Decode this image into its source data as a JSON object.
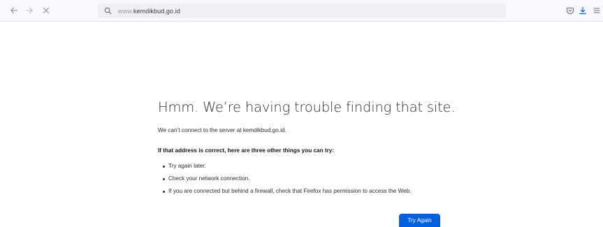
{
  "browser": {
    "icons": {
      "back": "arrow-left-icon",
      "forward": "arrow-right-icon",
      "stop": "close-icon",
      "search": "search-icon",
      "pocket": "pocket-icon",
      "downloads": "download-icon",
      "menu": "hamburger-menu-icon"
    },
    "urlbar": {
      "prefix": "www.",
      "domain": "kemdikbud.go.id"
    },
    "colors": {
      "toolbar_bg": "#f9f9fb",
      "urlbar_bg": "#f0f0f4",
      "accent": "#0061e0"
    }
  },
  "error_page": {
    "title": "Hmm. We’re having trouble finding that site.",
    "description": "We can’t connect to the server at kemdikbud.go.id.",
    "subheading": "If that address is correct, here are three other things you can try:",
    "suggestions": [
      "Try again later.",
      "Check your network connection.",
      "If you are connected but behind a firewall, check that Firefox has permission to access the Web."
    ],
    "try_again_label": "Try Again"
  }
}
